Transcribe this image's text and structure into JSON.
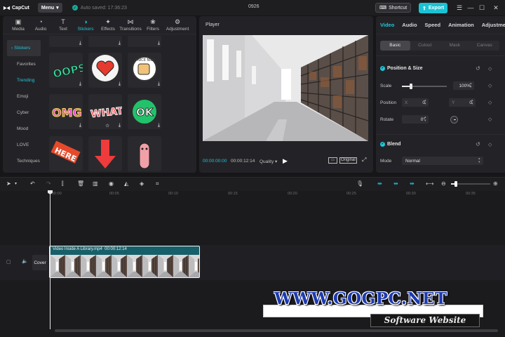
{
  "titlebar": {
    "app_name": "CapCut",
    "menu_label": "Menu",
    "autosave_text": "Auto saved: 17:36:23",
    "project_name": "0926",
    "shortcut_label": "Shortcut",
    "export_label": "Export",
    "accent_color": "#19c3d4"
  },
  "media_toolbar": {
    "items": [
      {
        "label": "Media",
        "icon": "media-icon"
      },
      {
        "label": "Audio",
        "icon": "audio-icon"
      },
      {
        "label": "Text",
        "icon": "text-icon"
      },
      {
        "label": "Stickers",
        "icon": "stickers-icon",
        "active": true
      },
      {
        "label": "Effects",
        "icon": "effects-icon"
      },
      {
        "label": "Transitions",
        "icon": "transitions-icon"
      },
      {
        "label": "Filters",
        "icon": "filters-icon"
      },
      {
        "label": "Adjustment",
        "icon": "adjustment-icon"
      }
    ]
  },
  "sticker_nav": {
    "items": [
      "Stickers",
      "Favorites",
      "Trending",
      "Emoji",
      "Cyber",
      "Mood",
      "LOVE",
      "Techniques"
    ],
    "active": "Stickers",
    "highlight": "Trending"
  },
  "stickers": {
    "row2": [
      "OOPS",
      "heart",
      "NICE NICE"
    ],
    "row3": [
      "OMG",
      "WHAT",
      "OK"
    ],
    "row4": [
      "HERE",
      "arrow-down",
      "finger"
    ]
  },
  "player": {
    "title": "Player",
    "current_time": "00:00:00:00",
    "total_time": "00:00:12:14",
    "quality_label": "Quality",
    "original_label": "Original"
  },
  "properties": {
    "tabs": [
      "Video",
      "Audio",
      "Speed",
      "Animation",
      "Adjustment"
    ],
    "active_tab": "Video",
    "sub_tabs": [
      "Basic",
      "Cutout",
      "Mask",
      "Canvas"
    ],
    "active_sub_tab": "Basic",
    "position_size_title": "Position & Size",
    "scale_label": "Scale",
    "scale_value": "100%",
    "scale_fraction": 0.2,
    "position_label": "Position",
    "pos_x_label": "X",
    "pos_x_value": "0",
    "pos_y_label": "Y",
    "pos_y_value": "0",
    "rotate_label": "Rotate",
    "rotate_value": "0°",
    "blend_title": "Blend",
    "mode_label": "Mode",
    "mode_value": "Normal"
  },
  "timeline": {
    "ticks": [
      "00:00",
      "00:05",
      "00:10",
      "00:15",
      "00:20",
      "00:25",
      "00:30",
      "00:35"
    ],
    "cover_label": "Cover",
    "clip_name": "Video Inside A Library.mp4",
    "clip_duration": "00:00:12:14",
    "zoom_fraction": 0.12
  },
  "watermark": {
    "title": "WWW.GOGPC.NET",
    "subtitle": "Software Website"
  }
}
